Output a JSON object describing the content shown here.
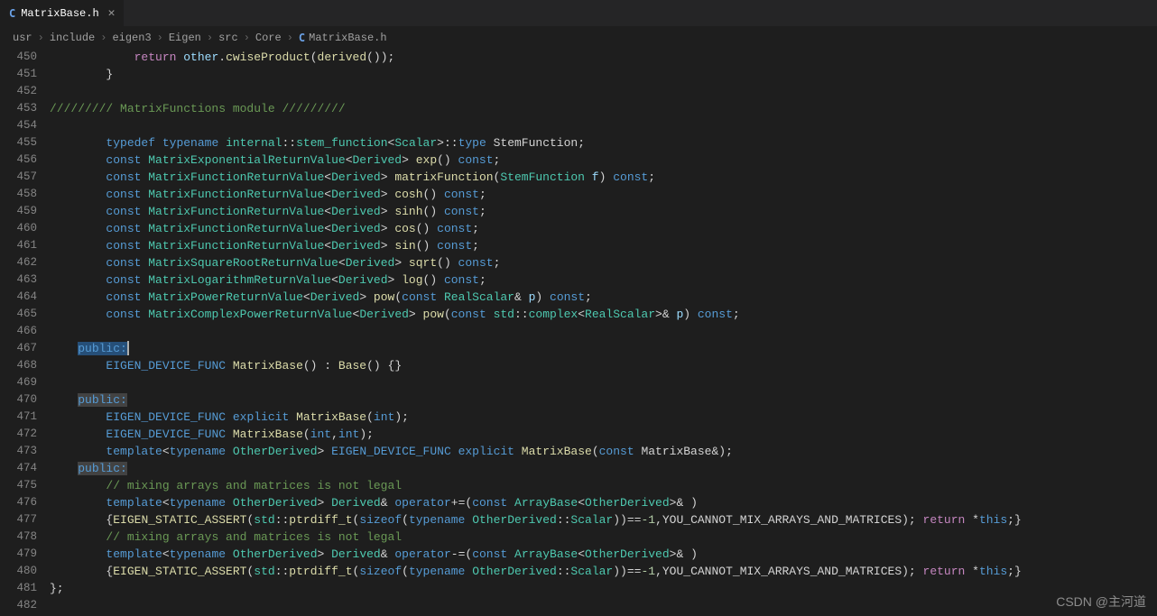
{
  "tab": {
    "icon_letter": "C",
    "filename": "MatrixBase.h"
  },
  "breadcrumbs": {
    "segs": [
      "usr",
      "include",
      "eigen3",
      "Eigen",
      "src",
      "Core"
    ],
    "file_icon": "C",
    "file": "MatrixBase.h"
  },
  "line_start": 450,
  "line_end": 482,
  "watermark": "CSDN @主河道",
  "code": {
    "l450": {
      "ret": "return",
      "other": "other",
      "cwise": "cwiseProduct",
      "derived": "derived"
    },
    "l453": {
      "comment": "///////// MatrixFunctions module /////////"
    },
    "l455": {
      "typedef": "typedef",
      "typename": "typename",
      "internal": "internal",
      "stem": "stem_function",
      "scalar": "Scalar",
      "type": "type",
      "stemfun": "StemFunction"
    },
    "l456": {
      "const1": "const",
      "cls": "MatrixExponentialReturnValue",
      "der": "Derived",
      "fn": "exp",
      "const2": "const"
    },
    "l457": {
      "const1": "const",
      "cls": "MatrixFunctionReturnValue",
      "der": "Derived",
      "fn": "matrixFunction",
      "ptype": "StemFunction",
      "pname": "f",
      "const2": "const"
    },
    "l458": {
      "const1": "const",
      "cls": "MatrixFunctionReturnValue",
      "der": "Derived",
      "fn": "cosh",
      "const2": "const"
    },
    "l459": {
      "const1": "const",
      "cls": "MatrixFunctionReturnValue",
      "der": "Derived",
      "fn": "sinh",
      "const2": "const"
    },
    "l460": {
      "const1": "const",
      "cls": "MatrixFunctionReturnValue",
      "der": "Derived",
      "fn": "cos",
      "const2": "const"
    },
    "l461": {
      "const1": "const",
      "cls": "MatrixFunctionReturnValue",
      "der": "Derived",
      "fn": "sin",
      "const2": "const"
    },
    "l462": {
      "const1": "const",
      "cls": "MatrixSquareRootReturnValue",
      "der": "Derived",
      "fn": "sqrt",
      "const2": "const"
    },
    "l463": {
      "const1": "const",
      "cls": "MatrixLogarithmReturnValue",
      "der": "Derived",
      "fn": "log",
      "const2": "const"
    },
    "l464": {
      "const1": "const",
      "cls": "MatrixPowerReturnValue",
      "der": "Derived",
      "fn": "pow",
      "pconst": "const",
      "ptype": "RealScalar",
      "pname": "p",
      "const2": "const"
    },
    "l465": {
      "const1": "const",
      "cls": "MatrixComplexPowerReturnValue",
      "der": "Derived",
      "fn": "pow",
      "pconst": "const",
      "std": "std",
      "complex": "complex",
      "real": "RealScalar",
      "pname": "p",
      "const2": "const"
    },
    "l467": {
      "public": "public:"
    },
    "l468": {
      "dev": "EIGEN_DEVICE_FUNC",
      "mb": "MatrixBase",
      "base": "Base"
    },
    "l470": {
      "public": "public:"
    },
    "l471": {
      "dev": "EIGEN_DEVICE_FUNC",
      "explicit": "explicit",
      "mb": "MatrixBase",
      "int": "int"
    },
    "l472": {
      "dev": "EIGEN_DEVICE_FUNC",
      "mb": "MatrixBase",
      "int": "int"
    },
    "l473": {
      "tpl": "template",
      "typename": "typename",
      "od": "OtherDerived",
      "dev": "EIGEN_DEVICE_FUNC",
      "explicit": "explicit",
      "mb": "MatrixBase",
      "const": "const"
    },
    "l474": {
      "public": "public:"
    },
    "l475": {
      "comment": "// mixing arrays and matrices is not legal"
    },
    "l476": {
      "tpl": "template",
      "typename": "typename",
      "od": "OtherDerived",
      "der": "Derived",
      "op": "operator",
      "sym": "+=",
      "const": "const",
      "ab": "ArrayBase"
    },
    "l477": {
      "assert": "EIGEN_STATIC_ASSERT",
      "std": "std",
      "pd": "ptrdiff_t",
      "sizeof": "sizeof",
      "typename": "typename",
      "od": "OtherDerived",
      "sc": "Scalar",
      "neg1": "-1",
      "msg": "YOU_CANNOT_MIX_ARRAYS_AND_MATRICES",
      "ret": "return",
      "this": "this"
    },
    "l478": {
      "comment": "// mixing arrays and matrices is not legal"
    },
    "l479": {
      "tpl": "template",
      "typename": "typename",
      "od": "OtherDerived",
      "der": "Derived",
      "op": "operator",
      "sym": "-=",
      "const": "const",
      "ab": "ArrayBase"
    },
    "l480": {
      "assert": "EIGEN_STATIC_ASSERT",
      "std": "std",
      "pd": "ptrdiff_t",
      "sizeof": "sizeof",
      "typename": "typename",
      "od": "OtherDerived",
      "sc": "Scalar",
      "neg1": "-1",
      "msg": "YOU_CANNOT_MIX_ARRAYS_AND_MATRICES",
      "ret": "return",
      "this": "this"
    }
  }
}
